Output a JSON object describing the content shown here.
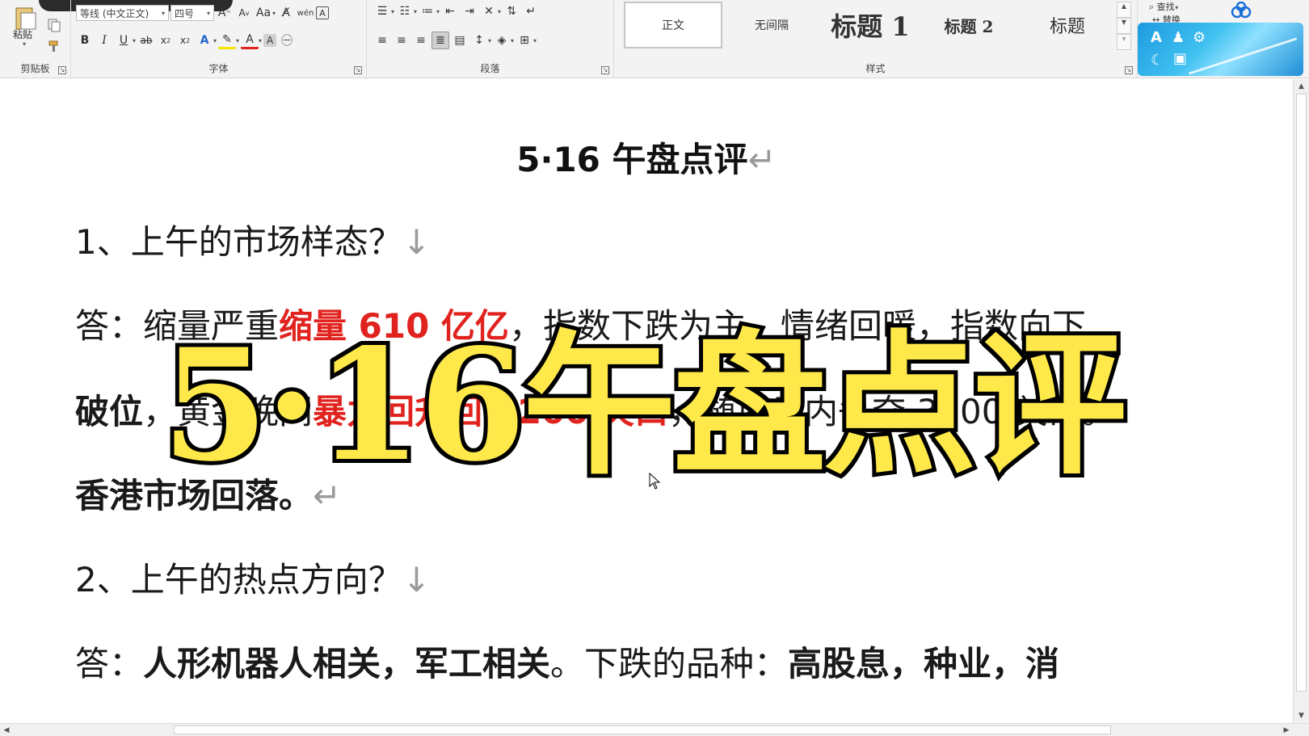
{
  "ribbon": {
    "clipboard": {
      "paste_label": "粘贴",
      "group_label": "剪贴板"
    },
    "font": {
      "font_name": "等线 (中文正文)",
      "font_size": "四号",
      "change_case": "Aa",
      "group_label": "字体"
    },
    "paragraph": {
      "group_label": "段落"
    },
    "styles": {
      "group_label": "样式",
      "items": [
        "正文",
        "无间隔",
        "标题 1",
        "标题 2",
        "标题"
      ]
    },
    "editing": {
      "find_label": "查找",
      "replace_label": "替换"
    }
  },
  "document": {
    "title": "5·16 午盘点评",
    "q1": "1、上午的市场样态？",
    "a1_line1": {
      "prefix": "答：缩量严重",
      "red": "缩量 610 亿亿",
      "rest": "，指数下跌为主，情绪回暖，指数向下"
    },
    "a1_line2": {
      "bold": "破位",
      "mid": "，黄金晚间",
      "red": "暴力回升回 3200 关口",
      "rest": "，随后日内争夺 3200 关口。"
    },
    "a1_line3": "香港市场回落。",
    "q2": "2、上午的热点方向？",
    "a2": {
      "prefix": "答：",
      "bold1": "人形机器人相关，军工相关",
      "mid": "。下跌的品种：",
      "bold2": "高股息，种业，消"
    }
  },
  "overlay": {
    "text": "5·16午盘点评"
  },
  "marks": {
    "paragraph": "↵",
    "line_break": "↓"
  }
}
